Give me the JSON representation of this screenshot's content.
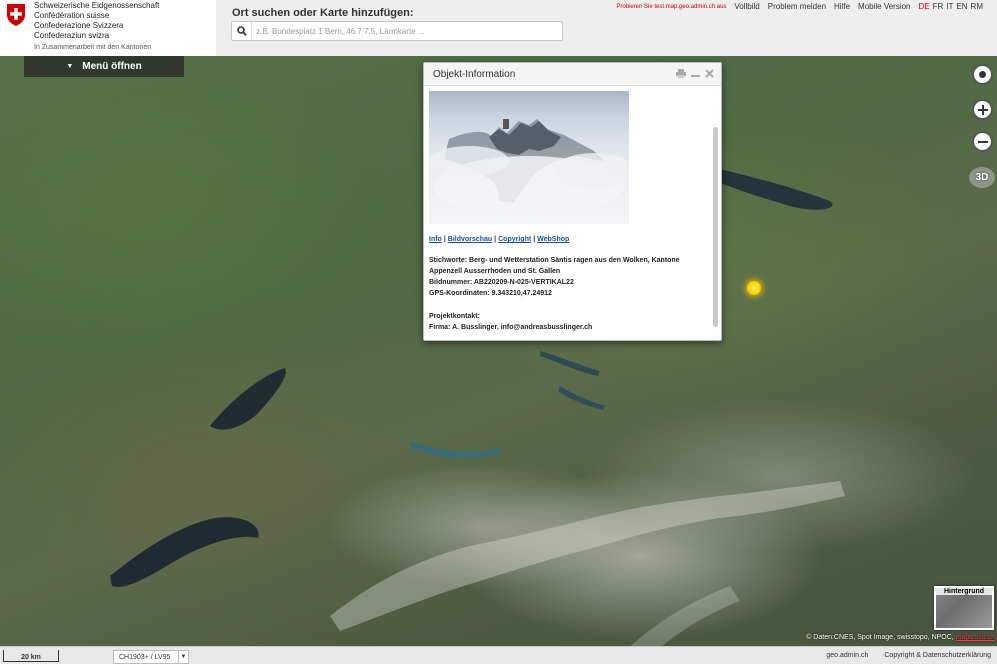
{
  "header": {
    "federal": [
      "Schweizerische Eidgenossenschaft",
      "Confédération suisse",
      "Confederazione Svizzera",
      "Confederaziun svizra"
    ],
    "cooperation": "In Zusammenarbeit mit den Kantonen",
    "search_label": "Ort suchen oder Karte hinzufügen:",
    "search_placeholder": "z.B. Bundesplatz 1 Bern, 46.7 7.5, Lärmkarte ...",
    "test_link": "Probieren Sie test.map.geo.admin.ch aus",
    "links": [
      "Vollbild",
      "Problem melden",
      "Hilfe",
      "Mobile Version"
    ],
    "languages": [
      "DE",
      "FR",
      "IT",
      "EN",
      "RM"
    ],
    "active_language": "DE"
  },
  "menu": {
    "label": "Menü öffnen"
  },
  "controls": {
    "three_d": "3D"
  },
  "popup": {
    "title": "Objekt-Information",
    "links": [
      "Info",
      "Bildvorschau",
      "Copyright",
      "WebShop"
    ],
    "keywords": "Stichworte: Berg- und Wetterstation Säntis ragen aus den Wolken, Kantone Appenzell Ausserrhoden und St. Gallen",
    "image_number": "Bildnummer: AB220209-N-025-VERTIKAL22",
    "gps": "GPS-Koordinaten: 9.343210,47.24912",
    "project_contact_label": "Projektkontakt:",
    "company": "Firma: A. Busslinger, info@andreasbusslinger.ch"
  },
  "background_map": {
    "label": "Hintergrund"
  },
  "copyright": {
    "text": "© Daten:CNES, Spot Image, swisstopo, NPOC,",
    "link": "maps.sso.ch"
  },
  "footer": {
    "scale": "20 km",
    "crs": "CH1903+ / LV95",
    "site": "geo.admin.ch",
    "legal": "Copyright & Datenschutzerklärung"
  },
  "colors": {
    "accent_red": "#d00000",
    "link_blue": "#1b4f9c",
    "marker": "#ffd200"
  }
}
